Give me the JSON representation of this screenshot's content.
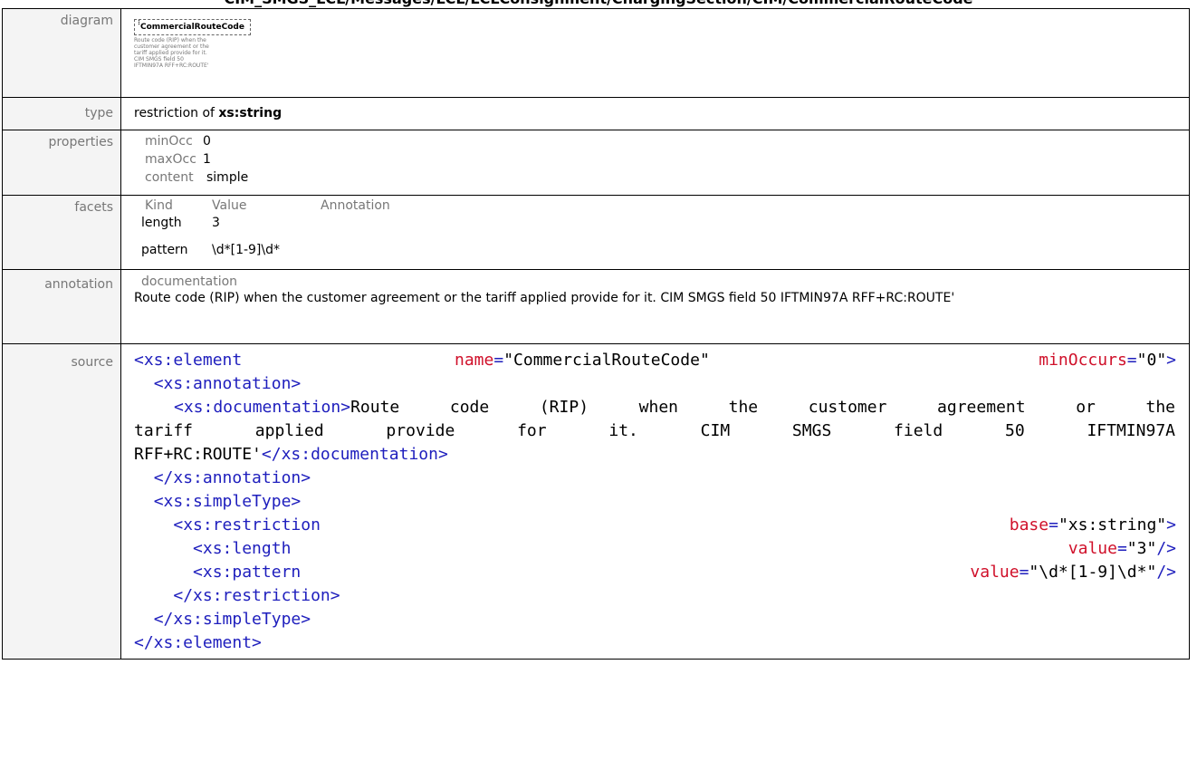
{
  "header": {
    "title": "CIM_SMGS_LCL/Messages/LCL/LCLConsignment/ChargingSection/CIM/CommercialRouteCode"
  },
  "rows": {
    "diagram": {
      "label": "diagram",
      "box_title": "CommercialRouteCode",
      "box_desc_lines": [
        "Route code (RIP) when the",
        "customer agreement or the",
        "tariff applied provide for it.",
        "CIM SMGS field 50",
        "IFTMIN97A RFF+RC:ROUTE'"
      ]
    },
    "type": {
      "label": "type",
      "prefix": "restriction of ",
      "value": "xs:string"
    },
    "properties": {
      "label": "properties",
      "items": [
        {
          "key": "minOcc",
          "value": "0"
        },
        {
          "key": "maxOcc",
          "value": "1"
        },
        {
          "key": "content",
          "value": "simple"
        }
      ]
    },
    "facets": {
      "label": "facets",
      "headers": [
        "Kind",
        "Value",
        "Annotation"
      ],
      "rows": [
        {
          "kind": "length",
          "value": "3"
        },
        {
          "kind": "pattern",
          "value": "\\d*[1-9]\\d*"
        }
      ]
    },
    "annotation": {
      "label": "annotation",
      "title": "documentation",
      "text": "Route code (RIP) when the customer agreement or the tariff applied provide for it.  CIM SMGS field 50 IFTMIN97A RFF+RC:ROUTE'"
    },
    "source": {
      "label": "source",
      "element_open": "<xs:element",
      "name_attr": "name",
      "name_val": "\"CommercialRouteCode\"",
      "minocc_attr": "minOccurs",
      "minocc_val": "\"0\"",
      "annotation_open": "<xs:annotation>",
      "documentation_open": "<xs:documentation>",
      "doc_text_1": "Route code (RIP) when the customer agreement or the",
      "doc_text_2": "tariff applied provide for it.  CIM SMGS field 50 IFTMIN97A",
      "doc_text_3": "RFF+RC:ROUTE'",
      "documentation_close": "</xs:documentation>",
      "annotation_close": "</xs:annotation>",
      "simpletype_open": "<xs:simpleType>",
      "restriction_open": "<xs:restriction",
      "base_attr": "base",
      "base_val": "\"xs:string\"",
      "length_open": "<xs:length",
      "length_attr": "value",
      "length_val": "\"3\"",
      "pattern_open": "<xs:pattern",
      "pattern_attr": "value",
      "pattern_val": "\"\\d*[1-9]\\d*\"",
      "restriction_close": "</xs:restriction>",
      "simpletype_close": "</xs:simpleType>",
      "element_close": "</xs:element>"
    }
  }
}
